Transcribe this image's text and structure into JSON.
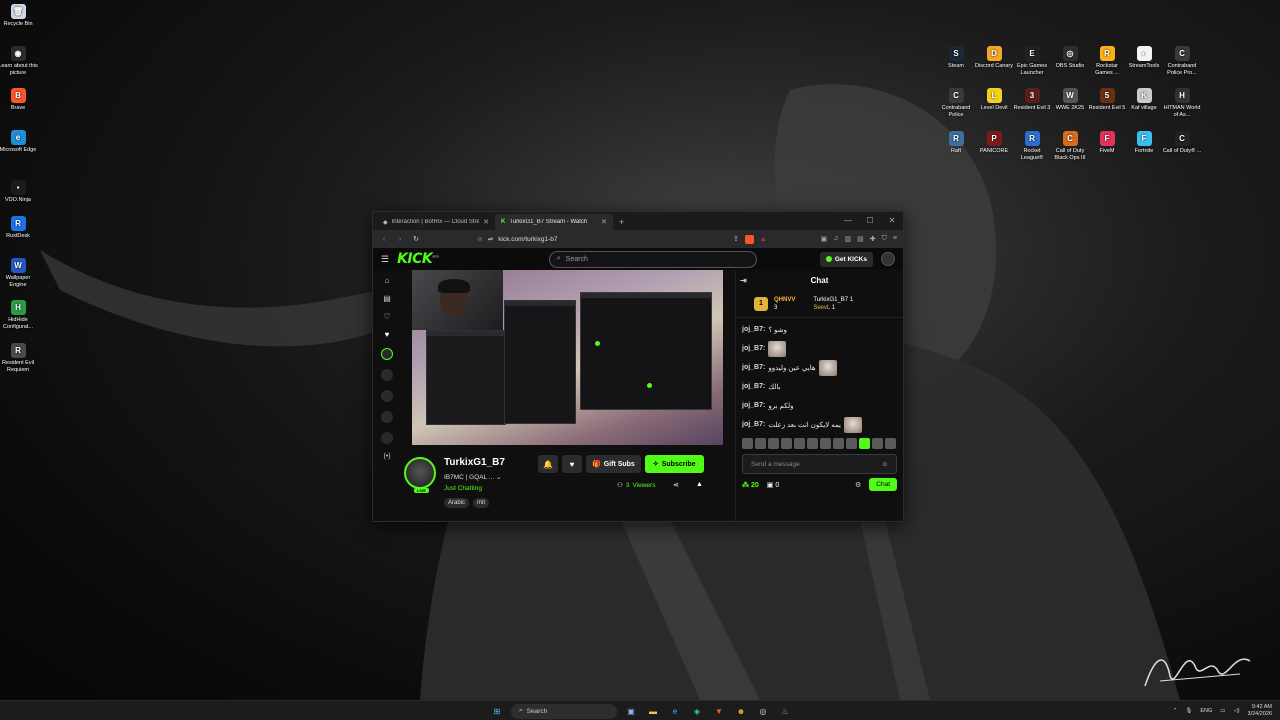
{
  "desktop": {
    "left_icons": [
      {
        "label": "Recycle Bin",
        "icon": "recycle-bin-icon",
        "color": "#cfd8e6",
        "glyph": "🗑"
      },
      {
        "label": "Learn about this picture",
        "icon": "camera-icon",
        "color": "#2b2b2b",
        "glyph": "◉"
      },
      {
        "label": "Brave",
        "icon": "brave-icon",
        "color": "#fb542b",
        "glyph": "B"
      },
      {
        "label": "Microsoft Edge",
        "icon": "edge-icon",
        "color": "#1e8fd6",
        "glyph": "e"
      },
      {
        "label": "VDO.Ninja",
        "icon": "vdo-ninja-icon",
        "color": "#1b1b1b",
        "glyph": "▪"
      },
      {
        "label": "RustDesk",
        "icon": "rustdesk-icon",
        "color": "#1a73e8",
        "glyph": "R"
      },
      {
        "label": "Wallpaper Engine",
        "icon": "wallpaper-engine-icon",
        "color": "#2457c5",
        "glyph": "W"
      },
      {
        "label": "HidHide Configurat...",
        "icon": "hidhide-icon",
        "color": "#2a9d46",
        "glyph": "H"
      },
      {
        "label": "Resident Evil Requiem",
        "icon": "resident-evil-icon",
        "color": "#4a4a4a",
        "glyph": "R"
      }
    ],
    "right_icons": [
      {
        "label": "Steam",
        "icon": "steam-icon",
        "color": "#1b2838",
        "glyph": "S"
      },
      {
        "label": "Discord Canary",
        "icon": "discord-icon",
        "color": "#f6a623",
        "glyph": "D"
      },
      {
        "label": "Epic Games Launcher",
        "icon": "epic-games-icon",
        "color": "#222",
        "glyph": "E"
      },
      {
        "label": "OBS Studio",
        "icon": "obs-icon",
        "color": "#302e31",
        "glyph": "◎"
      },
      {
        "label": "Rockstar Games ...",
        "icon": "rockstar-icon",
        "color": "#fcaf17",
        "glyph": "R"
      },
      {
        "label": "StreamTools",
        "icon": "streamtools-icon",
        "color": "#f4f4f4",
        "glyph": "◐"
      },
      {
        "label": "Contraband Police Pro...",
        "icon": "contraband-pro-icon",
        "color": "#3a3a3a",
        "glyph": "C"
      },
      {
        "label": "Contraband Police",
        "icon": "contraband-icon",
        "color": "#3a3a3a",
        "glyph": "C"
      },
      {
        "label": "Level Devil",
        "icon": "level-devil-icon",
        "color": "#f2d21a",
        "glyph": "L"
      },
      {
        "label": "Resident Evil 3",
        "icon": "resident-evil-3-icon",
        "color": "#5a1e1e",
        "glyph": "3"
      },
      {
        "label": "WWE 2K25",
        "icon": "wwe-icon",
        "color": "#555",
        "glyph": "W"
      },
      {
        "label": "Resident Evil 5",
        "icon": "resident-evil-5-icon",
        "color": "#6b3010",
        "glyph": "5"
      },
      {
        "label": "Kaf village",
        "icon": "kaf-village-icon",
        "color": "#ccc",
        "glyph": "K"
      },
      {
        "label": "HITMAN World of As...",
        "icon": "hitman-icon",
        "color": "#333",
        "glyph": "H"
      },
      {
        "label": "Raft",
        "icon": "raft-icon",
        "color": "#3f6fa0",
        "glyph": "R"
      },
      {
        "label": "PANICORE",
        "icon": "panicore-icon",
        "color": "#7a1b1b",
        "glyph": "P"
      },
      {
        "label": "Rocket League®",
        "icon": "rocket-league-icon",
        "color": "#2d6fd1",
        "glyph": "R"
      },
      {
        "label": "Call of Duty Black Ops III",
        "icon": "cod-bo3-icon",
        "color": "#d96a1b",
        "glyph": "C"
      },
      {
        "label": "FiveM",
        "icon": "fivem-icon",
        "color": "#e3335b",
        "glyph": "F"
      },
      {
        "label": "Fortnite",
        "icon": "fortnite-icon",
        "color": "#3ac0ee",
        "glyph": "F"
      },
      {
        "label": "Call of Duty® ...",
        "icon": "cod-icon",
        "color": "#222",
        "glyph": "C"
      }
    ]
  },
  "browser": {
    "tabs": [
      {
        "title": "Interaction | BotRix — Cloud Streami...",
        "active": false
      },
      {
        "title": "TurkixG1_B7 Stream - Watch",
        "active": true
      }
    ],
    "new_tab": "+",
    "url": "kick.com/turkixg1-b7",
    "window_controls": [
      "—",
      "☐",
      "✕"
    ]
  },
  "kick": {
    "logo": "KICK",
    "logo_badge": "BETA",
    "search_placeholder": "Search",
    "get_kicks": "Get KICKs",
    "stream": {
      "streamer": "TurkixG1_B7",
      "title": "IB7MC | GQAL ...",
      "category": "Just Chatting",
      "tags": [
        "Arabic",
        "mit"
      ],
      "live_badge": "LIVE",
      "gift_subs": "Gift Subs",
      "subscribe": "Subscribe",
      "viewers_count": "3",
      "viewers_label": "Viewers"
    },
    "chat": {
      "title": "Chat",
      "leaderboard": [
        {
          "rank_name": "QHNVV",
          "value": "3"
        },
        {
          "rank_name": "TurkixG1_B7",
          "value": "1"
        },
        {
          "rank_name": "SeevL",
          "value": "1"
        }
      ],
      "messages": [
        {
          "user": "joj_B7:",
          "text": "وشو ؟",
          "emote": false
        },
        {
          "user": "joj_B7:",
          "text": "",
          "emote": true
        },
        {
          "user": "joj_B7:",
          "text": "هايي عين وليدوو",
          "emote": true
        },
        {
          "user": "joj_B7:",
          "text": "بالك",
          "emote": false
        },
        {
          "user": "joj_B7:",
          "text": "ولكم برو",
          "emote": false
        },
        {
          "user": "joj_B7:",
          "text": "يمه لايكون انت بعد زعلت",
          "emote": true
        }
      ],
      "input_placeholder": "Send a message",
      "points": "20",
      "gifts": "0",
      "send_label": "Chat"
    }
  },
  "taskbar": {
    "search_label": "Search",
    "language": "ENG",
    "time": "9:42 AM",
    "date": "3/24/2026"
  },
  "colors": {
    "kick_green": "#53fc18",
    "gold": "#f6b840"
  }
}
